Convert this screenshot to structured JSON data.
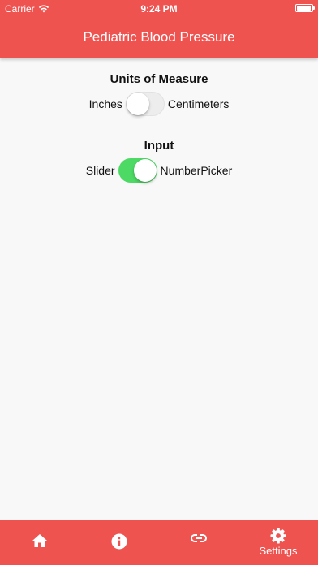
{
  "status_bar": {
    "carrier": "Carrier",
    "time": "9:24 PM"
  },
  "header": {
    "title": "Pediatric Blood Pressure"
  },
  "settings": {
    "units": {
      "title": "Units of Measure",
      "left_label": "Inches",
      "right_label": "Centimeters",
      "on": false
    },
    "input": {
      "title": "Input",
      "left_label": "Slider",
      "right_label": "NumberPicker",
      "on": true
    }
  },
  "tabbar": {
    "tabs": [
      {
        "icon": "home-icon",
        "label": ""
      },
      {
        "icon": "info-icon",
        "label": ""
      },
      {
        "icon": "link-icon",
        "label": ""
      },
      {
        "icon": "gear-icon",
        "label": "Settings",
        "active": true
      }
    ]
  },
  "colors": {
    "brand": "#ef5350",
    "toggle_on": "#4cd964",
    "background": "#f8f8f8"
  }
}
